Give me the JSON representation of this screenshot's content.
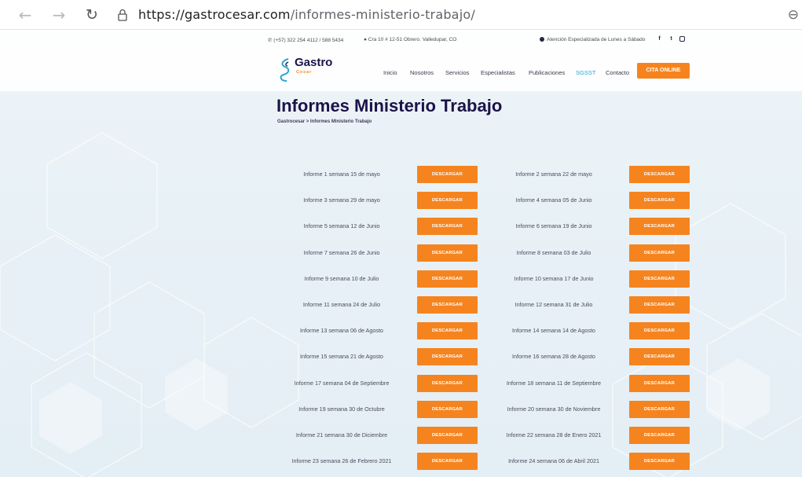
{
  "browser": {
    "url_host": "https://gastrocesar.com",
    "url_path": "/informes-ministerio-trabajo/"
  },
  "topbar": {
    "phone": "(+57) 322 254 4112 / 588 5434",
    "address": "Cra 10 # 12-51 Obrero. Valledupar, CO",
    "schedule": "Atención Especializada de Lunes a Sábado"
  },
  "header": {
    "logo_text": "Gastro",
    "logo_sub": "Cesar",
    "nav": [
      "Inicio",
      "Nosotros",
      "Servicios",
      "Especialistas",
      "Publicaciones",
      "SGSST",
      "Contacto"
    ],
    "active_nav": "SGSST",
    "cta": "CITA ONLINE"
  },
  "page": {
    "title": "Informes Ministerio Trabajo",
    "breadcrumb": "Gastrocesar > Informes Ministerio Trabajo"
  },
  "download_label": "DESCARGAR",
  "reports": [
    [
      "Informe 1 semana 15 de mayo",
      "Informe 2 semana 22 de mayo"
    ],
    [
      "Informe 3 semana 29 de mayo",
      "Informe 4 semana 05 de Junio"
    ],
    [
      "Informe 5 semana 12 de Junio",
      "Informe 6 semana 19 de Junio"
    ],
    [
      "Informe 7 semana 26 de Junio",
      "Informe 8 semana 03 de Julio"
    ],
    [
      "Informe 9 semana 10 de Julio",
      "Informe 10 semana 17 de Junio"
    ],
    [
      "Informe 11 semana 24 de Julio",
      "Informe 12 semana 31 de Julio"
    ],
    [
      "Informe 13 semana 06 de Agosto",
      "Informe 14 semana 14 de Agosto"
    ],
    [
      "Informe 15 semana 21 de Agosto",
      "Informe 16 semana 28 de Agosto"
    ],
    [
      "Informe 17 semana 04 de Septiembre",
      "Informe 18 semana 11 de Septiembre"
    ],
    [
      "Informe 19 semana 30 de Octubre",
      "Informe 20 semana 30 de Noviembre"
    ],
    [
      "Informe 21 semana 30 de Diciembre",
      "Informe 22 semana 28 de Enero 2021"
    ],
    [
      "Informe 23 semana 26 de Febrero 2021",
      "Informe 24 semana 06 de Abril 2021"
    ]
  ],
  "colors": {
    "accent": "#f5841f",
    "brand": "#1b1348",
    "active_nav": "#2aa5d6"
  }
}
